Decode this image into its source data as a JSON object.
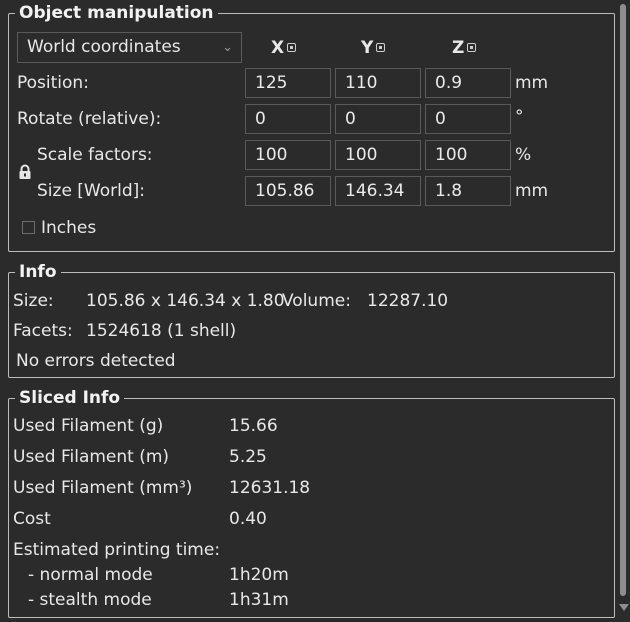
{
  "object_manipulation": {
    "title": "Object manipulation",
    "coord_select": "World coordinates",
    "axes": [
      "X",
      "Y",
      "Z"
    ],
    "rows": {
      "position": {
        "label": "Position:",
        "x": "125",
        "y": "110",
        "z": "0.9",
        "unit": "mm"
      },
      "rotate": {
        "label": "Rotate (relative):",
        "x": "0",
        "y": "0",
        "z": "0",
        "unit": "°"
      },
      "scale": {
        "label": "Scale factors:",
        "x": "100",
        "y": "100",
        "z": "100",
        "unit": "%"
      },
      "size": {
        "label": "Size [World]:",
        "x": "105.86",
        "y": "146.34",
        "z": "1.8",
        "unit": "mm"
      }
    },
    "inches_label": "Inches",
    "inches_checked": false
  },
  "info": {
    "title": "Info",
    "size_label": "Size:",
    "size_value": "105.86 x 146.34 x 1.80",
    "volume_label": "Volume:",
    "volume_value": "12287.10",
    "facets_label": "Facets:",
    "facets_value": "1524618 (1 shell)",
    "errors": "No errors detected"
  },
  "sliced_info": {
    "title": "Sliced Info",
    "rows": [
      {
        "label": "Used Filament (g)",
        "value": "15.66"
      },
      {
        "label": "Used Filament (m)",
        "value": "5.25"
      },
      {
        "label": "Used Filament (mm³)",
        "value": "12631.18"
      },
      {
        "label": "Cost",
        "value": "0.40"
      }
    ],
    "est_label": "Estimated printing time:",
    "normal_label": "- normal mode",
    "normal_value": "1h20m",
    "stealth_label": "- stealth mode",
    "stealth_value": "1h31m"
  }
}
